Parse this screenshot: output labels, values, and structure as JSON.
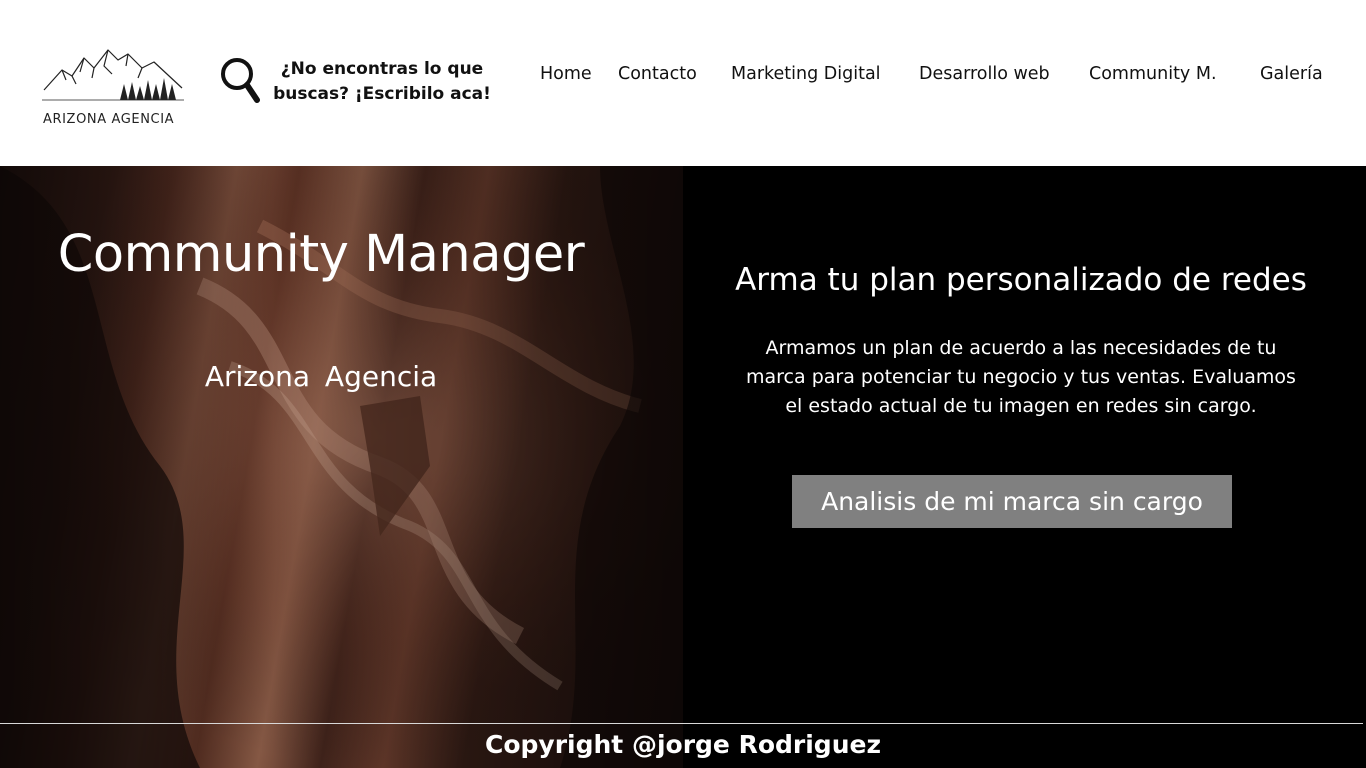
{
  "header": {
    "logo_text": "ARIZONA AGENCIA",
    "search_text": "¿No encontras lo que buscas? ¡Escribilo aca!",
    "nav": [
      {
        "label": "Home"
      },
      {
        "label": "Contacto"
      },
      {
        "label": "Marketing Digital"
      },
      {
        "label": "Desarrollo web"
      },
      {
        "label": "Community M."
      },
      {
        "label": "Galería"
      }
    ]
  },
  "hero": {
    "title": "Community Manager",
    "subtitle": "Arizona  Agencia",
    "plan_title": "Arma tu plan personalizado de redes",
    "plan_description": "Armamos un plan de acuerdo a las necesidades de tu marca para potenciar tu negocio y tus ventas. Evaluamos el estado actual de tu imagen en redes sin cargo.",
    "cta_label": "Analisis de mi marca sin cargo"
  },
  "footer": {
    "copyright": "Copyright @jorge Rodriguez"
  },
  "icons": {
    "logo": "mountain-logo-icon",
    "search": "search-icon"
  },
  "colors": {
    "header_bg": "#ffffff",
    "hero_right_bg": "#000000",
    "cta_bg": "#808080",
    "text_light": "#ffffff"
  }
}
